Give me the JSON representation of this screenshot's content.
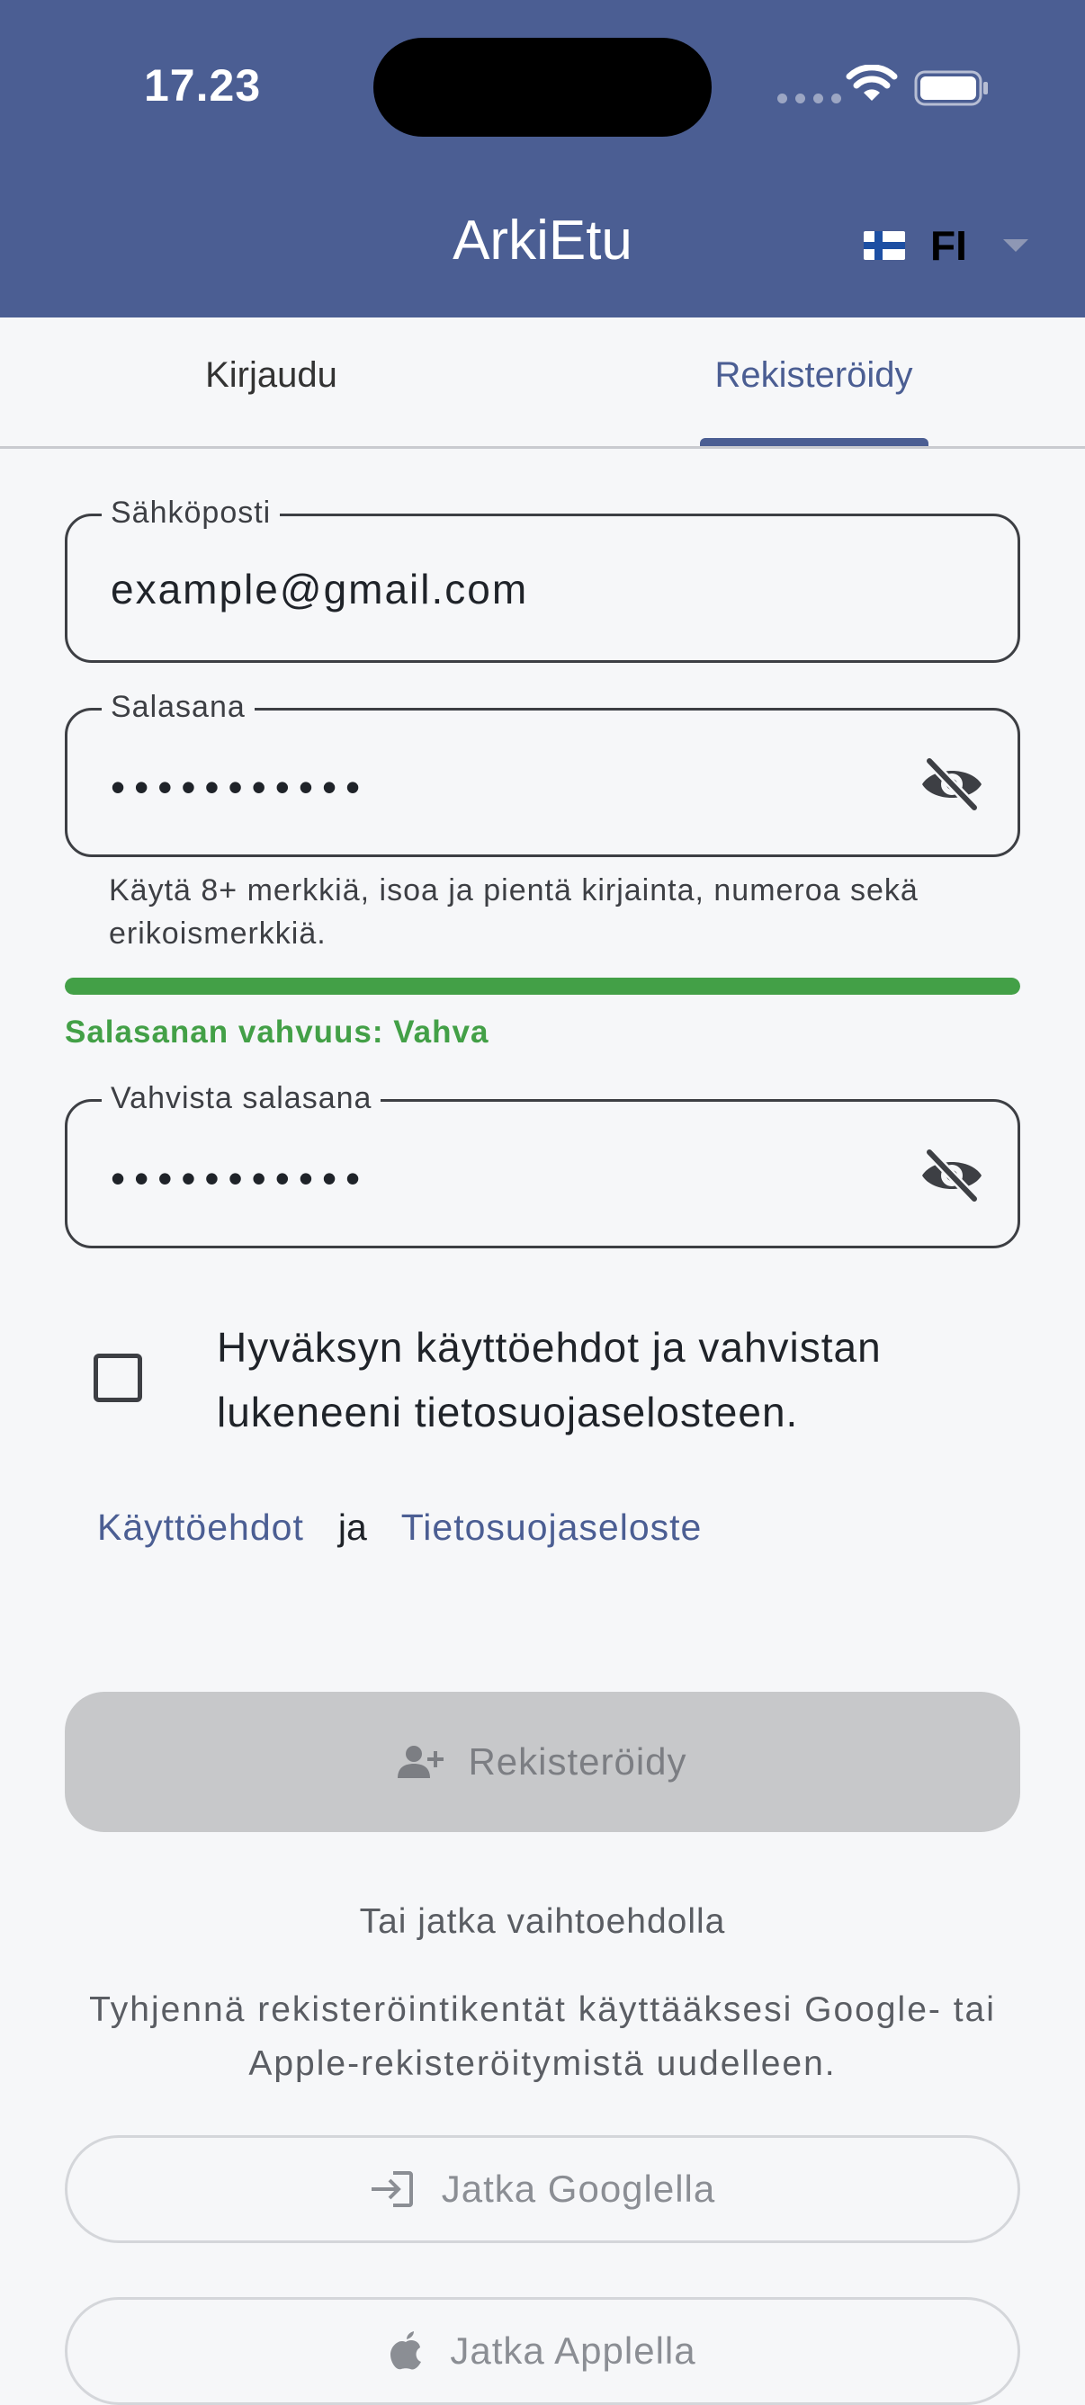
{
  "status_bar": {
    "time": "17.23"
  },
  "header": {
    "title": "ArkiEtu",
    "language": "FI"
  },
  "tabs": {
    "login": "Kirjaudu",
    "register": "Rekisteröidy",
    "active": "register"
  },
  "form": {
    "email": {
      "label": "Sähköposti",
      "value": "example@gmail.com"
    },
    "password": {
      "label": "Salasana",
      "value": "•••••••••••"
    },
    "password_hint": "Käytä 8+ merkkiä, isoa ja pientä kirjainta, numeroa sekä erikoismerkkiä.",
    "strength": {
      "text": "Salasanan vahvuus: Vahva",
      "level": 1.0,
      "color": "#43a047"
    },
    "confirm_password": {
      "label": "Vahvista salasana",
      "value": "•••••••••••"
    },
    "consent": {
      "text": "Hyväksyn käyttöehdot ja vahvistan lukeneeni tietosuojaselosteen.",
      "checked": false
    },
    "links": {
      "terms": "Käyttöehdot",
      "separator": "ja",
      "privacy": "Tietosuojaseloste"
    },
    "register_button": "Rekisteröidy"
  },
  "alternatives": {
    "title": "Tai jatka vaihtoehdolla",
    "note": "Tyhjennä rekisteröintikentät käyttääksesi Google- tai Apple-rekisteröitymistä uudelleen.",
    "google_button": "Jatka Googlella",
    "apple_button": "Jatka Applella"
  },
  "colors": {
    "primary": "#4b5e93",
    "success": "#43a047",
    "disabled": "#c7c8ca"
  },
  "icons": [
    "wifi-icon",
    "battery-icon",
    "finland-flag-icon",
    "chevron-down-icon",
    "eye-off-icon",
    "add-user-icon",
    "login-icon",
    "apple-icon"
  ]
}
